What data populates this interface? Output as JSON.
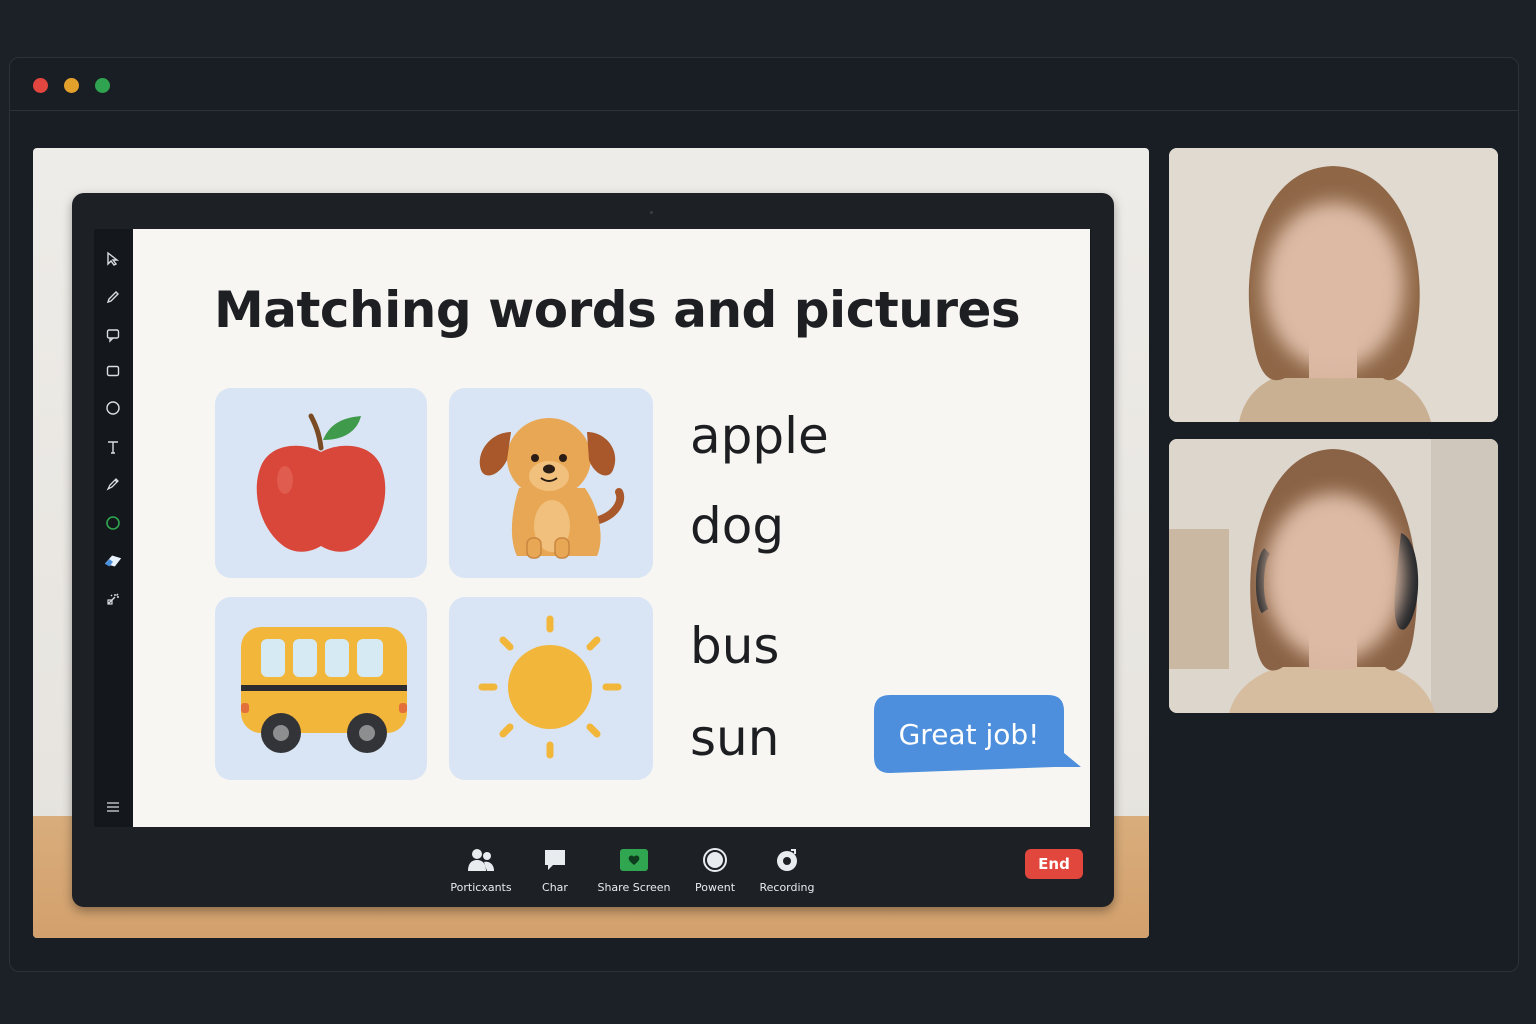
{
  "window": {
    "controls": [
      "close",
      "minimize",
      "maximize"
    ]
  },
  "slide": {
    "title": "Matching words and pictures",
    "cards": [
      {
        "icon": "apple-icon"
      },
      {
        "icon": "dog-icon"
      },
      {
        "icon": "bus-icon"
      },
      {
        "icon": "sun-icon"
      }
    ],
    "words": [
      "apple",
      "dog",
      "bus",
      "sun"
    ],
    "bubble_text": "Great job!"
  },
  "toolbar": {
    "tools": [
      "select-arrow-icon",
      "pen-icon",
      "comment-icon",
      "rectangle-icon",
      "circle-icon",
      "text-icon",
      "highlighter-icon",
      "color-green-icon",
      "eraser-icon",
      "magic-wand-icon",
      "menu-icon"
    ]
  },
  "controls": {
    "participants": "Porticxants",
    "chat": "Char",
    "share": "Share Screen",
    "powent": "Powent",
    "recording": "Recording",
    "end": "End"
  },
  "colors": {
    "accent_green": "#2fa64f",
    "end_red": "#e2473d",
    "bubble_blue": "#4d8fdc",
    "card_blue": "#d9e5f4"
  }
}
